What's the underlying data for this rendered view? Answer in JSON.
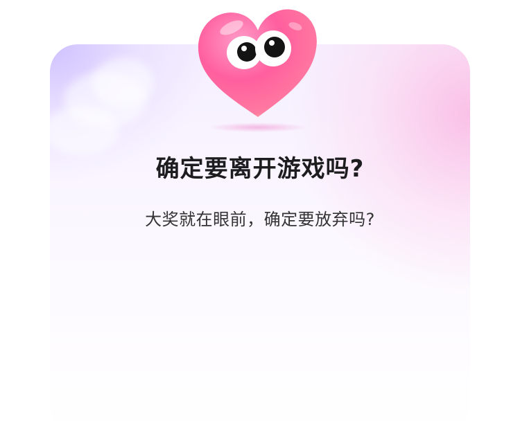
{
  "dialog": {
    "title": "确定要离开游戏吗?",
    "message": "大奖就在眼前，确定要放弃吗?",
    "mascot_icon": "pink-heart-with-googly-eyes",
    "colors": {
      "heart": "#ff5f9e",
      "heart_light": "#ffc7a8",
      "title_text": "#1d1d1f",
      "message_text": "#333333",
      "bg_top_left": "#cdbdff",
      "bg_top_right": "#f9bde4"
    }
  }
}
